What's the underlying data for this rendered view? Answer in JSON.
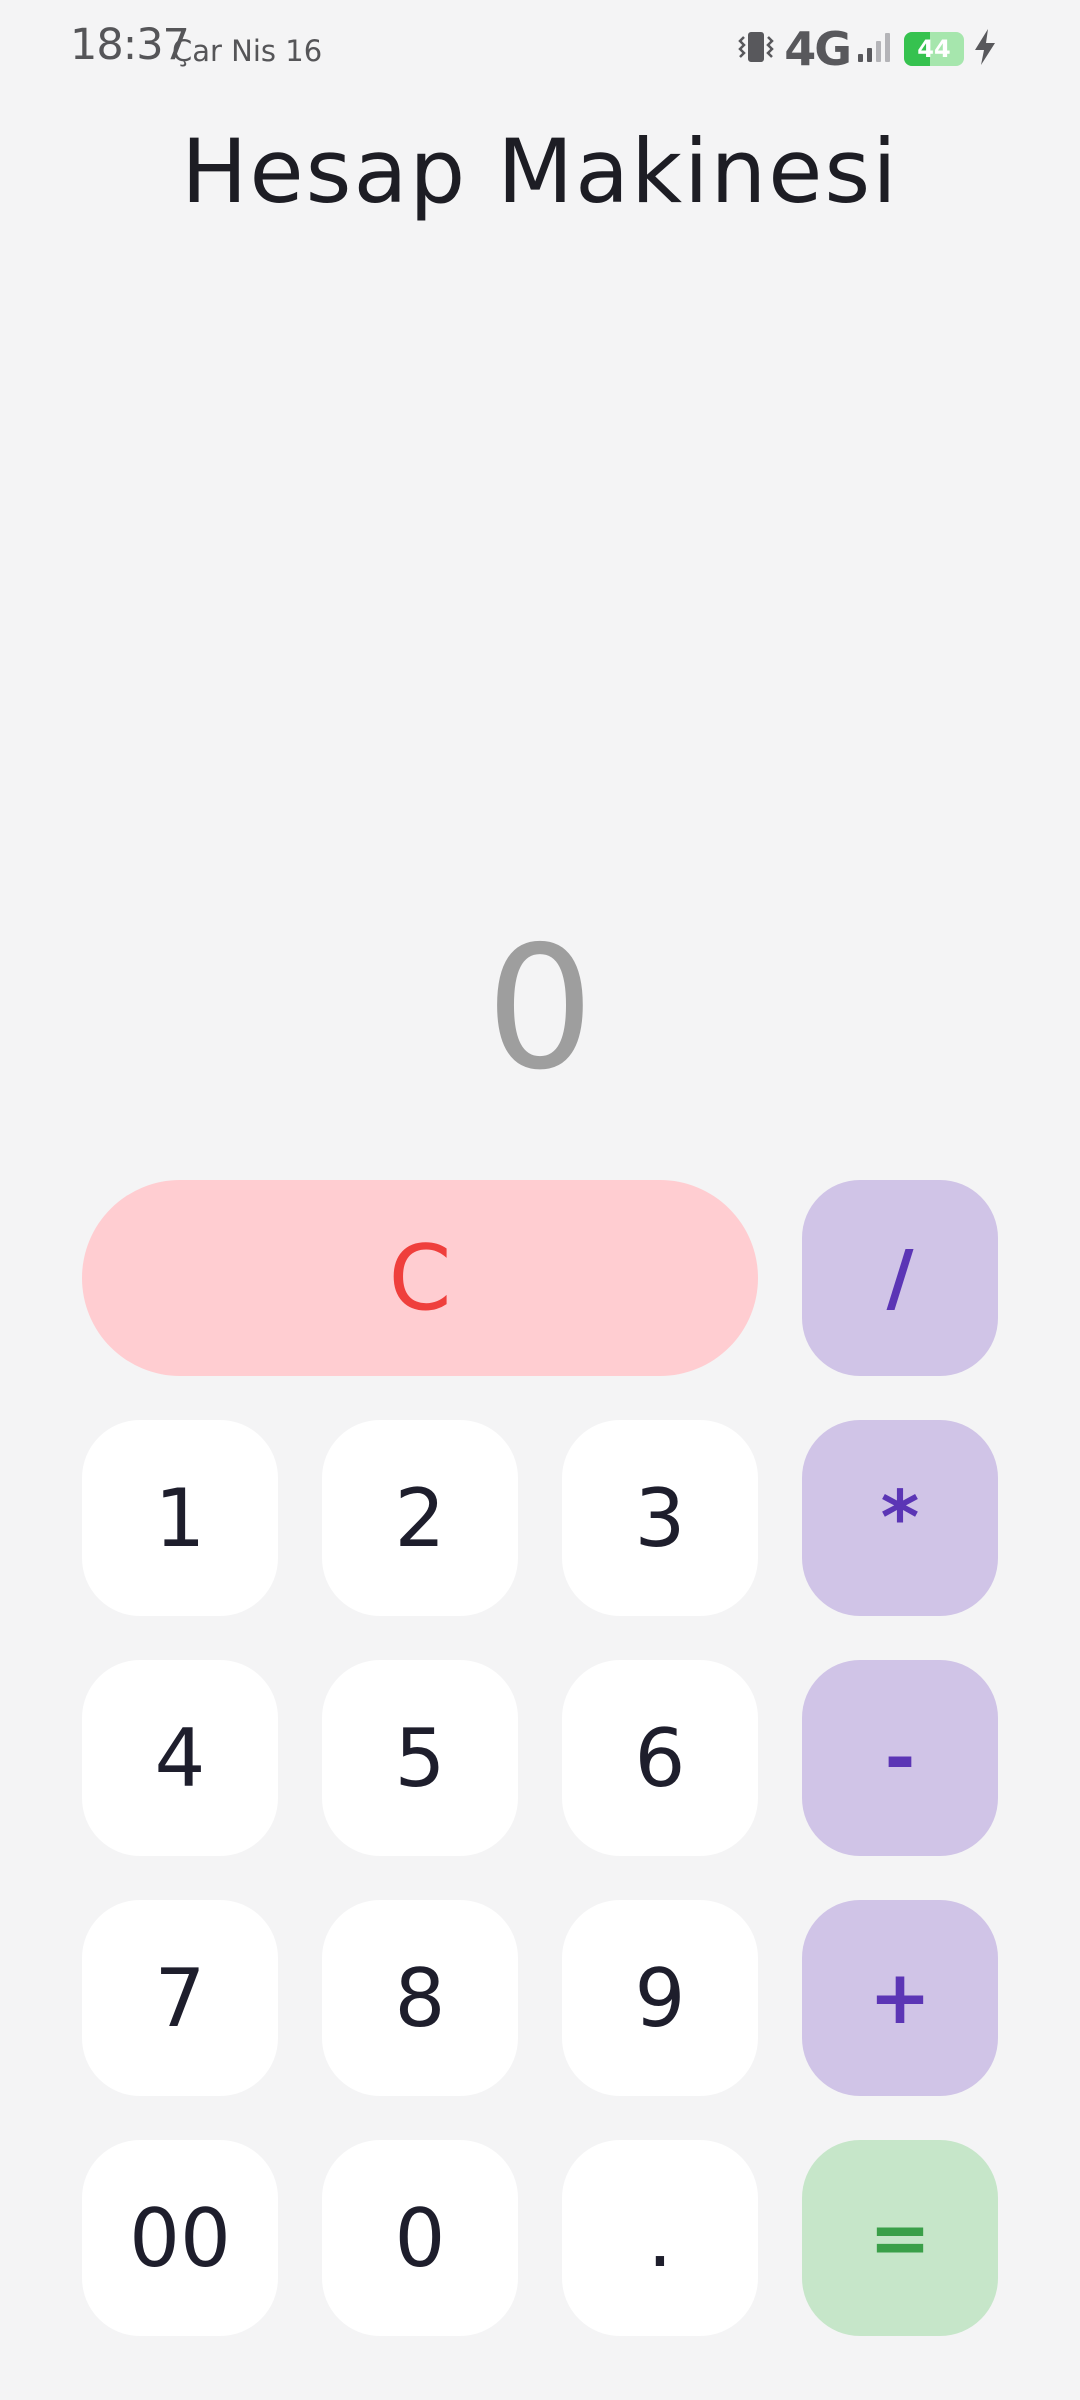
{
  "status_bar": {
    "time": "18:37",
    "date": "Çar Nis 16",
    "network": "4G",
    "battery_level": "44",
    "battery_fraction": 0.44,
    "icons": [
      "vibrate-icon",
      "signal-icon",
      "battery-icon",
      "charging-icon"
    ]
  },
  "app": {
    "title": "Hesap Makinesi"
  },
  "display": {
    "value": "0"
  },
  "keys": {
    "clear": "C",
    "divide": "/",
    "multiply": "*",
    "subtract": "-",
    "add": "+",
    "equals": "=",
    "one": "1",
    "two": "2",
    "three": "3",
    "four": "4",
    "five": "5",
    "six": "6",
    "seven": "7",
    "eight": "8",
    "nine": "9",
    "double_zero": "00",
    "zero": "0",
    "decimal": "."
  },
  "colors": {
    "background": "#f4f4f5",
    "digit_key": "#ffffff",
    "operator_key": "#d0c4e7",
    "operator_text": "#5b35b5",
    "clear_key": "#ffcdd1",
    "clear_text": "#ef3f3c",
    "equals_key": "#c6e6c9",
    "equals_text": "#3a9f49",
    "display_text": "#9e9e9e"
  }
}
